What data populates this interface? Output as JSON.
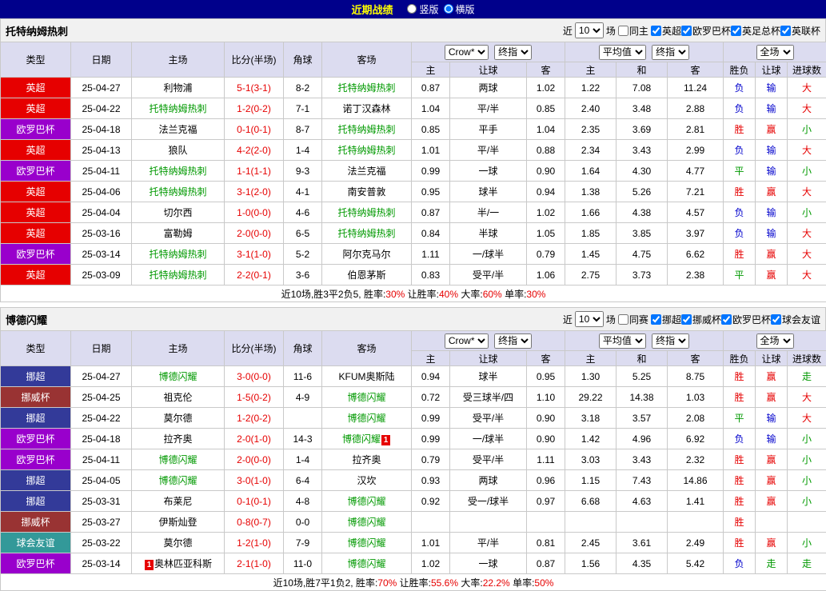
{
  "topbar": {
    "title": "近期战绩",
    "options": [
      {
        "label": "竖版",
        "selected": false
      },
      {
        "label": "横版",
        "selected": true
      }
    ]
  },
  "table_header": {
    "fixed_cols": [
      "类型",
      "日期",
      "主场",
      "比分(半场)",
      "角球",
      "客场"
    ],
    "odds_select": "Crow*",
    "final_select": "终指",
    "avg_select": "平均值",
    "scope_select": "全场",
    "sub_cols": [
      "主",
      "让球",
      "客",
      "主",
      "和",
      "客",
      "胜负",
      "让球",
      "进球数"
    ]
  },
  "type_colors": {
    "英超": "#e60000",
    "欧罗巴杯": "#9900cc",
    "挪超": "#333a99",
    "挪威杯": "#993333",
    "球会友谊": "#339999"
  },
  "result_colors": {
    "胜": "#e60000",
    "赢": "#e60000",
    "大": "#e60000",
    "负": "#0000cc",
    "输": "#0000cc",
    "平": "#009900",
    "走": "#009900",
    "小": "#009900"
  },
  "sections": [
    {
      "team": "托特纳姆热刺",
      "filter": {
        "prefix": "近",
        "count": "10",
        "suffix": "场",
        "same_label": "同主",
        "same_checked": false,
        "leagues": [
          {
            "label": "英超",
            "checked": true
          },
          {
            "label": "欧罗巴杯",
            "checked": true
          },
          {
            "label": "英足总杯",
            "checked": true
          },
          {
            "label": "英联杯",
            "checked": true
          }
        ]
      },
      "rows": [
        {
          "type": "英超",
          "date": "25-04-27",
          "home": {
            "name": "利物浦",
            "focus": false
          },
          "score": "5-1(3-1)",
          "corner": "8-2",
          "away": {
            "name": "托特纳姆热刺",
            "focus": true
          },
          "odds": [
            "0.87",
            "两球",
            "1.02"
          ],
          "avg": [
            "1.22",
            "7.08",
            "11.24"
          ],
          "res": [
            "负",
            "输",
            "大"
          ]
        },
        {
          "type": "英超",
          "date": "25-04-22",
          "home": {
            "name": "托特纳姆热刺",
            "focus": true
          },
          "score": "1-2(0-2)",
          "corner": "7-1",
          "away": {
            "name": "诺丁汉森林",
            "focus": false
          },
          "odds": [
            "1.04",
            "平/半",
            "0.85"
          ],
          "avg": [
            "2.40",
            "3.48",
            "2.88"
          ],
          "res": [
            "负",
            "输",
            "大"
          ]
        },
        {
          "type": "欧罗巴杯",
          "date": "25-04-18",
          "home": {
            "name": "法兰克福",
            "focus": false
          },
          "score": "0-1(0-1)",
          "corner": "8-7",
          "away": {
            "name": "托特纳姆热刺",
            "focus": true
          },
          "odds": [
            "0.85",
            "平手",
            "1.04"
          ],
          "avg": [
            "2.35",
            "3.69",
            "2.81"
          ],
          "res": [
            "胜",
            "赢",
            "小"
          ]
        },
        {
          "type": "英超",
          "date": "25-04-13",
          "home": {
            "name": "狼队",
            "focus": false
          },
          "score": "4-2(2-0)",
          "corner": "1-4",
          "away": {
            "name": "托特纳姆热刺",
            "focus": true
          },
          "odds": [
            "1.01",
            "平/半",
            "0.88"
          ],
          "avg": [
            "2.34",
            "3.43",
            "2.99"
          ],
          "res": [
            "负",
            "输",
            "大"
          ]
        },
        {
          "type": "欧罗巴杯",
          "date": "25-04-11",
          "home": {
            "name": "托特纳姆热刺",
            "focus": true
          },
          "score": "1-1(1-1)",
          "corner": "9-3",
          "away": {
            "name": "法兰克福",
            "focus": false
          },
          "odds": [
            "0.99",
            "一球",
            "0.90"
          ],
          "avg": [
            "1.64",
            "4.30",
            "4.77"
          ],
          "res": [
            "平",
            "输",
            "小"
          ]
        },
        {
          "type": "英超",
          "date": "25-04-06",
          "home": {
            "name": "托特纳姆热刺",
            "focus": true
          },
          "score": "3-1(2-0)",
          "corner": "4-1",
          "away": {
            "name": "南安普敦",
            "focus": false
          },
          "odds": [
            "0.95",
            "球半",
            "0.94"
          ],
          "avg": [
            "1.38",
            "5.26",
            "7.21"
          ],
          "res": [
            "胜",
            "赢",
            "大"
          ]
        },
        {
          "type": "英超",
          "date": "25-04-04",
          "home": {
            "name": "切尔西",
            "focus": false
          },
          "score": "1-0(0-0)",
          "corner": "4-6",
          "away": {
            "name": "托特纳姆热刺",
            "focus": true
          },
          "odds": [
            "0.87",
            "半/一",
            "1.02"
          ],
          "avg": [
            "1.66",
            "4.38",
            "4.57"
          ],
          "res": [
            "负",
            "输",
            "小"
          ]
        },
        {
          "type": "英超",
          "date": "25-03-16",
          "home": {
            "name": "富勒姆",
            "focus": false
          },
          "score": "2-0(0-0)",
          "corner": "6-5",
          "away": {
            "name": "托特纳姆热刺",
            "focus": true
          },
          "odds": [
            "0.84",
            "半球",
            "1.05"
          ],
          "avg": [
            "1.85",
            "3.85",
            "3.97"
          ],
          "res": [
            "负",
            "输",
            "大"
          ]
        },
        {
          "type": "欧罗巴杯",
          "date": "25-03-14",
          "home": {
            "name": "托特纳姆热刺",
            "focus": true
          },
          "score": "3-1(1-0)",
          "corner": "5-2",
          "away": {
            "name": "阿尔克马尔",
            "focus": false
          },
          "odds": [
            "1.11",
            "一/球半",
            "0.79"
          ],
          "avg": [
            "1.45",
            "4.75",
            "6.62"
          ],
          "res": [
            "胜",
            "赢",
            "大"
          ]
        },
        {
          "type": "英超",
          "date": "25-03-09",
          "home": {
            "name": "托特纳姆热刺",
            "focus": true
          },
          "score": "2-2(0-1)",
          "corner": "3-6",
          "away": {
            "name": "伯恩茅斯",
            "focus": false
          },
          "odds": [
            "0.83",
            "受平/半",
            "1.06"
          ],
          "avg": [
            "2.75",
            "3.73",
            "2.38"
          ],
          "res": [
            "平",
            "赢",
            "大"
          ]
        }
      ],
      "summary": [
        {
          "text": "近10场,胜3平2负5, 胜率:",
          "red": false
        },
        {
          "text": "30%",
          "red": true
        },
        {
          "text": " 让胜率:",
          "red": false
        },
        {
          "text": "40%",
          "red": true
        },
        {
          "text": " 大率:",
          "red": false
        },
        {
          "text": "60%",
          "red": true
        },
        {
          "text": " 单率:",
          "red": false
        },
        {
          "text": "30%",
          "red": true
        }
      ]
    },
    {
      "team": "博德闪耀",
      "filter": {
        "prefix": "近",
        "count": "10",
        "suffix": "场",
        "same_label": "同赛",
        "same_checked": false,
        "leagues": [
          {
            "label": "挪超",
            "checked": true
          },
          {
            "label": "挪威杯",
            "checked": true
          },
          {
            "label": "欧罗巴杯",
            "checked": true
          },
          {
            "label": "球会友谊",
            "checked": true
          }
        ]
      },
      "rows": [
        {
          "type": "挪超",
          "date": "25-04-27",
          "home": {
            "name": "博德闪耀",
            "focus": true
          },
          "score": "3-0(0-0)",
          "corner": "11-6",
          "away": {
            "name": "KFUM奥斯陆",
            "focus": false
          },
          "odds": [
            "0.94",
            "球半",
            "0.95"
          ],
          "avg": [
            "1.30",
            "5.25",
            "8.75"
          ],
          "res": [
            "胜",
            "赢",
            "走"
          ]
        },
        {
          "type": "挪威杯",
          "date": "25-04-25",
          "home": {
            "name": "祖克伦",
            "focus": false
          },
          "score": "1-5(0-2)",
          "corner": "4-9",
          "away": {
            "name": "博德闪耀",
            "focus": true
          },
          "odds": [
            "0.72",
            "受三球半/四",
            "1.10"
          ],
          "avg": [
            "29.22",
            "14.38",
            "1.03"
          ],
          "res": [
            "胜",
            "赢",
            "大"
          ]
        },
        {
          "type": "挪超",
          "date": "25-04-22",
          "home": {
            "name": "莫尔德",
            "focus": false
          },
          "score": "1-2(0-2)",
          "corner": "",
          "away": {
            "name": "博德闪耀",
            "focus": true
          },
          "odds": [
            "0.99",
            "受平/半",
            "0.90"
          ],
          "avg": [
            "3.18",
            "3.57",
            "2.08"
          ],
          "res": [
            "平",
            "输",
            "大"
          ]
        },
        {
          "type": "欧罗巴杯",
          "date": "25-04-18",
          "home": {
            "name": "拉齐奥",
            "focus": false
          },
          "score": "2-0(1-0)",
          "corner": "14-3",
          "away": {
            "name": "博德闪耀",
            "focus": true,
            "card_after": "1"
          },
          "odds": [
            "0.99",
            "一/球半",
            "0.90"
          ],
          "avg": [
            "1.42",
            "4.96",
            "6.92"
          ],
          "res": [
            "负",
            "输",
            "小"
          ]
        },
        {
          "type": "欧罗巴杯",
          "date": "25-04-11",
          "home": {
            "name": "博德闪耀",
            "focus": true
          },
          "score": "2-0(0-0)",
          "corner": "1-4",
          "away": {
            "name": "拉齐奥",
            "focus": false
          },
          "odds": [
            "0.79",
            "受平/半",
            "1.11"
          ],
          "avg": [
            "3.03",
            "3.43",
            "2.32"
          ],
          "res": [
            "胜",
            "赢",
            "小"
          ]
        },
        {
          "type": "挪超",
          "date": "25-04-05",
          "home": {
            "name": "博德闪耀",
            "focus": true
          },
          "score": "3-0(1-0)",
          "corner": "6-4",
          "away": {
            "name": "汉坎",
            "focus": false
          },
          "odds": [
            "0.93",
            "两球",
            "0.96"
          ],
          "avg": [
            "1.15",
            "7.43",
            "14.86"
          ],
          "res": [
            "胜",
            "赢",
            "小"
          ]
        },
        {
          "type": "挪超",
          "date": "25-03-31",
          "home": {
            "name": "布莱尼",
            "focus": false
          },
          "score": "0-1(0-1)",
          "corner": "4-8",
          "away": {
            "name": "博德闪耀",
            "focus": true
          },
          "odds": [
            "0.92",
            "受一/球半",
            "0.97"
          ],
          "avg": [
            "6.68",
            "4.63",
            "1.41"
          ],
          "res": [
            "胜",
            "赢",
            "小"
          ]
        },
        {
          "type": "挪威杯",
          "date": "25-03-27",
          "home": {
            "name": "伊斯灿登",
            "focus": false
          },
          "score": "0-8(0-7)",
          "corner": "0-0",
          "away": {
            "name": "博德闪耀",
            "focus": true
          },
          "odds": [
            "",
            "",
            ""
          ],
          "avg": [
            "",
            "",
            ""
          ],
          "res": [
            "胜",
            "",
            ""
          ]
        },
        {
          "type": "球会友谊",
          "date": "25-03-22",
          "home": {
            "name": "莫尔德",
            "focus": false
          },
          "score": "1-2(1-0)",
          "corner": "7-9",
          "away": {
            "name": "博德闪耀",
            "focus": true
          },
          "odds": [
            "1.01",
            "平/半",
            "0.81"
          ],
          "avg": [
            "2.45",
            "3.61",
            "2.49"
          ],
          "res": [
            "胜",
            "赢",
            "小"
          ]
        },
        {
          "type": "欧罗巴杯",
          "date": "25-03-14",
          "home": {
            "name": "奥林匹亚科斯",
            "focus": false,
            "card_before": "1"
          },
          "score": "2-1(1-0)",
          "corner": "11-0",
          "away": {
            "name": "博德闪耀",
            "focus": true
          },
          "odds": [
            "1.02",
            "一球",
            "0.87"
          ],
          "avg": [
            "1.56",
            "4.35",
            "5.42"
          ],
          "res": [
            "负",
            "走",
            "走"
          ]
        }
      ],
      "summary": [
        {
          "text": "近10场,胜7平1负2, 胜率:",
          "red": false
        },
        {
          "text": "70%",
          "red": true
        },
        {
          "text": " 让胜率:",
          "red": false
        },
        {
          "text": "55.6%",
          "red": true
        },
        {
          "text": " 大率:",
          "red": false
        },
        {
          "text": "22.2%",
          "red": true
        },
        {
          "text": " 单率:",
          "red": false
        },
        {
          "text": "50%",
          "red": true
        }
      ]
    }
  ]
}
